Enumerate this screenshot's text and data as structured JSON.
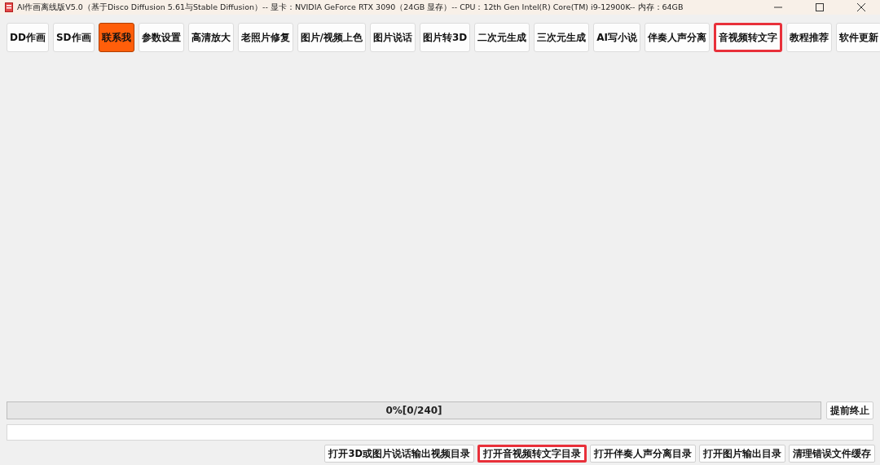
{
  "window": {
    "title": "AI作画离线版V5.0（基于Disco Diffusion 5.61与Stable Diffusion）-- 显卡：NVIDIA GeForce RTX 3090（24GB 显存）-- CPU：12th Gen Intel(R) Core(TM) i9-12900K-- 内存：64GB"
  },
  "toolbar": [
    {
      "label": "DD作画",
      "accent": false,
      "highlighted": false
    },
    {
      "label": "SD作画",
      "accent": false,
      "highlighted": false
    },
    {
      "label": "联系我",
      "accent": true,
      "highlighted": false
    },
    {
      "label": "参数设置",
      "accent": false,
      "highlighted": false
    },
    {
      "label": "高清放大",
      "accent": false,
      "highlighted": false
    },
    {
      "label": "老照片修复",
      "accent": false,
      "highlighted": false
    },
    {
      "label": "图片/视频上色",
      "accent": false,
      "highlighted": false
    },
    {
      "label": "图片说话",
      "accent": false,
      "highlighted": false
    },
    {
      "label": "图片转3D",
      "accent": false,
      "highlighted": false
    },
    {
      "label": "二次元生成",
      "accent": false,
      "highlighted": false
    },
    {
      "label": "三次元生成",
      "accent": false,
      "highlighted": false
    },
    {
      "label": "AI写小说",
      "accent": false,
      "highlighted": false
    },
    {
      "label": "伴奏人声分离",
      "accent": false,
      "highlighted": false
    },
    {
      "label": "音视频转文字",
      "accent": false,
      "highlighted": true
    },
    {
      "label": "教程推荐",
      "accent": false,
      "highlighted": false
    },
    {
      "label": "软件更新",
      "accent": false,
      "highlighted": false
    }
  ],
  "progress": {
    "level": 0,
    "text": "0%[0/240]",
    "stop_button": "提前终止"
  },
  "bottom_buttons": [
    {
      "label": "打开3D或图片说话输出视频目录",
      "highlighted": false
    },
    {
      "label": "打开音视频转文字目录",
      "highlighted": true
    },
    {
      "label": "打开伴奏人声分离目录",
      "highlighted": false
    },
    {
      "label": "打开图片输出目录",
      "highlighted": false
    },
    {
      "label": "清理错误文件缓存",
      "highlighted": false
    }
  ]
}
